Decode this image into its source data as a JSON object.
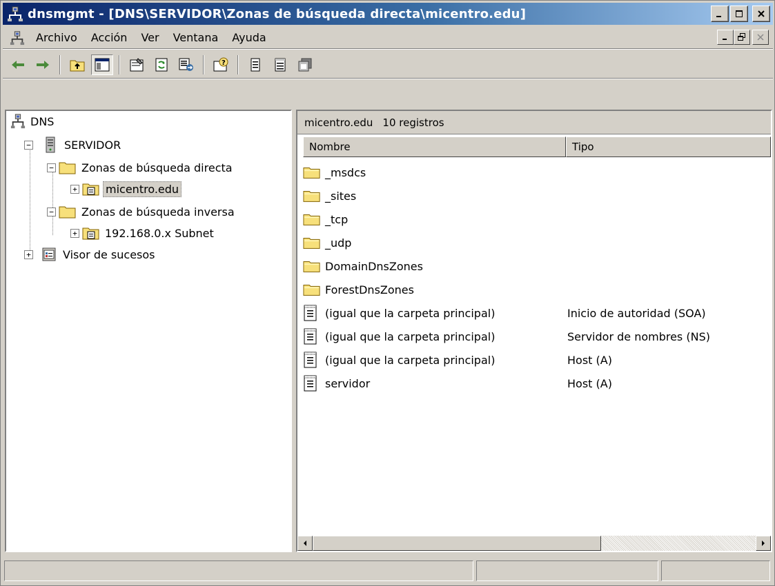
{
  "window": {
    "title": "dnsmgmt - [DNS\\SERVIDOR\\Zonas de búsqueda directa\\micentro.edu]",
    "caption_buttons": [
      "minimize",
      "maximize",
      "close"
    ]
  },
  "menubar": {
    "items": [
      "Archivo",
      "Acción",
      "Ver",
      "Ventana",
      "Ayuda"
    ]
  },
  "toolbar": {
    "buttons": [
      "back",
      "forward",
      "up-one-level",
      "show-hide-console-tree",
      "properties",
      "refresh",
      "export-list",
      "help",
      "show-list",
      "show-detail",
      "show-new-window"
    ]
  },
  "tree": {
    "root": "DNS",
    "nodes": [
      {
        "label": "SERVIDOR",
        "icon": "server-icon"
      },
      {
        "label": "Zonas de búsqueda directa",
        "icon": "folder-icon"
      },
      {
        "label": "micentro.edu",
        "icon": "zone-icon",
        "selected": true
      },
      {
        "label": "Zonas de búsqueda inversa",
        "icon": "folder-icon"
      },
      {
        "label": "192.168.0.x Subnet",
        "icon": "zone-icon"
      },
      {
        "label": "Visor de sucesos",
        "icon": "event-viewer-icon"
      }
    ]
  },
  "details": {
    "header_name": "micentro.edu",
    "header_count": "10 registros",
    "columns": [
      "Nombre",
      "Tipo"
    ],
    "rows": [
      {
        "name": "_msdcs",
        "type": "",
        "icon": "folder"
      },
      {
        "name": "_sites",
        "type": "",
        "icon": "folder"
      },
      {
        "name": "_tcp",
        "type": "",
        "icon": "folder"
      },
      {
        "name": "_udp",
        "type": "",
        "icon": "folder"
      },
      {
        "name": "DomainDnsZones",
        "type": "",
        "icon": "folder"
      },
      {
        "name": "ForestDnsZones",
        "type": "",
        "icon": "folder"
      },
      {
        "name": "(igual que la carpeta principal)",
        "type": "Inicio de autoridad (SOA)",
        "icon": "record"
      },
      {
        "name": "(igual que la carpeta principal)",
        "type": "Servidor de nombres (NS)",
        "icon": "record"
      },
      {
        "name": "(igual que la carpeta principal)",
        "type": "Host (A)",
        "icon": "record"
      },
      {
        "name": "servidor",
        "type": "Host (A)",
        "icon": "record"
      }
    ]
  },
  "colors": {
    "title_gradient_start": "#0a246a",
    "title_gradient_end": "#a6caf0",
    "face": "#d4d0c8",
    "folder": "#f7e07b"
  }
}
